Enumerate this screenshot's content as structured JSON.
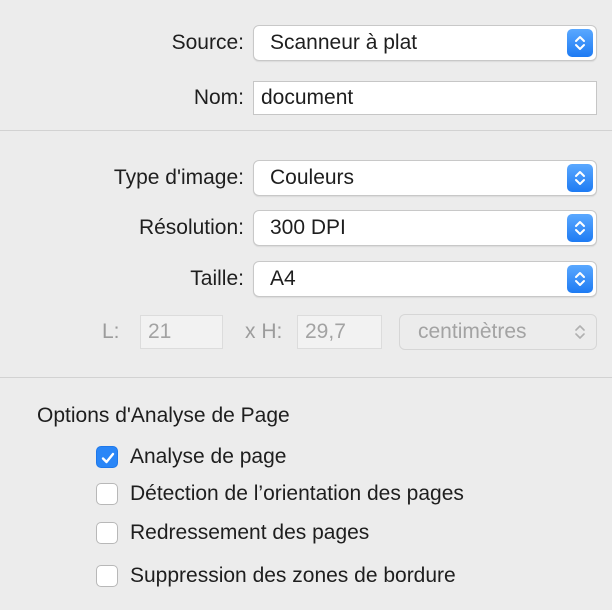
{
  "scanner": {
    "source": {
      "label": "Source:",
      "value": "Scanneur à plat"
    },
    "name": {
      "label": "Nom:",
      "value": "document"
    }
  },
  "image": {
    "type": {
      "label": "Type d'image:",
      "value": "Couleurs"
    },
    "resolution": {
      "label": "Résolution:",
      "value": "300 DPI"
    },
    "size": {
      "label": "Taille:",
      "value": "A4"
    },
    "dimensions": {
      "width_label": "L:",
      "width_value": "21",
      "height_label": "x H:",
      "height_value": "29,7",
      "unit": "centimètres"
    }
  },
  "page_analysis": {
    "title": "Options d'Analyse de Page",
    "options": [
      {
        "label": "Analyse de page",
        "checked": true
      },
      {
        "label": "Détection de l’orientation des pages",
        "checked": false
      },
      {
        "label": "Redressement des pages",
        "checked": false
      },
      {
        "label": "Suppression des zones de bordure",
        "checked": false
      }
    ]
  },
  "colors": {
    "accent": "#2a86f7",
    "background": "#ececec"
  }
}
